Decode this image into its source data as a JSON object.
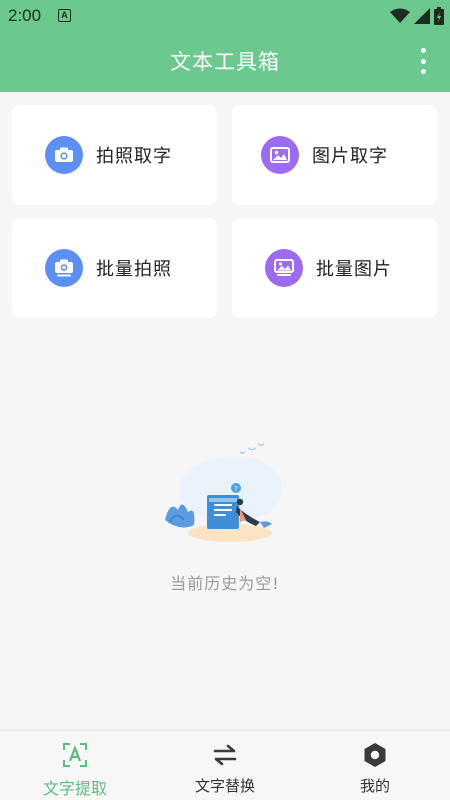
{
  "status_bar": {
    "time": "2:00",
    "notification_letter": "A"
  },
  "header": {
    "title": "文本工具箱"
  },
  "cards": [
    {
      "label": "拍照取字",
      "icon": "camera-icon",
      "color": "#5b8ff3"
    },
    {
      "label": "图片取字",
      "icon": "image-icon",
      "color": "#9c6bf0"
    },
    {
      "label": "批量拍照",
      "icon": "camera-stack-icon",
      "color": "#5b8ff3"
    },
    {
      "label": "批量图片",
      "icon": "image-stack-icon",
      "color": "#9c6bf0"
    }
  ],
  "empty_state": {
    "message": "当前历史为空!"
  },
  "bottom_nav": {
    "items": [
      {
        "label": "文字提取",
        "icon": "text-scan-icon",
        "active": true
      },
      {
        "label": "文字替换",
        "icon": "swap-arrows-icon",
        "active": false
      },
      {
        "label": "我的",
        "icon": "hexagon-icon",
        "active": false
      }
    ]
  },
  "colors": {
    "primary": "#6cc98d",
    "active_nav": "#5dbd7f",
    "blue_icon": "#5b8ff3",
    "purple_icon": "#9c6bf0"
  }
}
